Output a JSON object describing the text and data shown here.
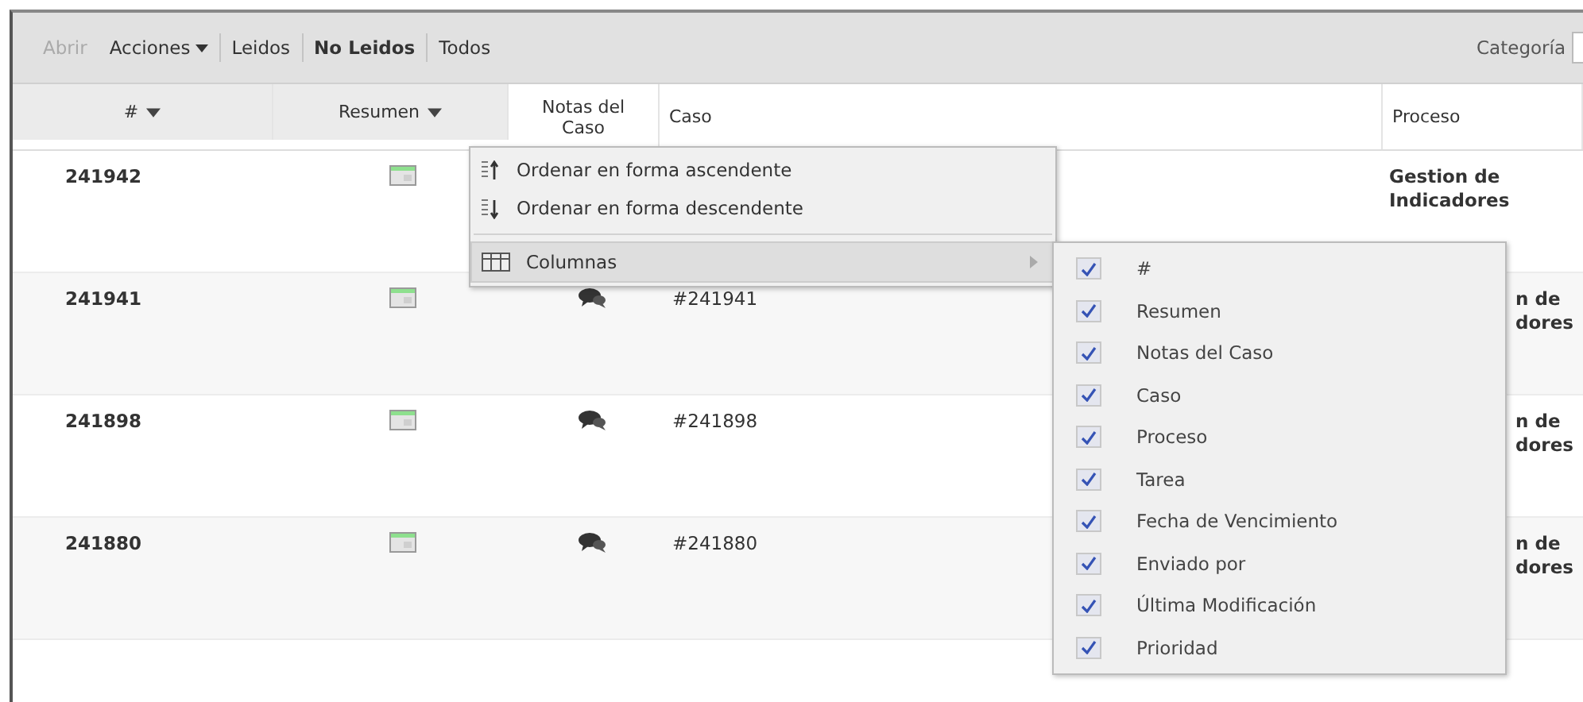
{
  "toolbar": {
    "items": [
      {
        "label": "Abrir",
        "kind": "action",
        "disabled": true,
        "selected": false
      },
      {
        "label": "Acciones",
        "kind": "dropdown",
        "disabled": false,
        "selected": false
      },
      {
        "label": "Leidos",
        "kind": "filter",
        "disabled": false,
        "selected": false
      },
      {
        "label": "No Leidos",
        "kind": "filter",
        "disabled": false,
        "selected": true
      },
      {
        "label": "Todos",
        "kind": "filter",
        "disabled": false,
        "selected": false
      }
    ],
    "category_label": "Categoría"
  },
  "table": {
    "columns": [
      {
        "label": "#",
        "sortable": true
      },
      {
        "label": "Resumen",
        "sortable": true
      },
      {
        "label": "Notas del Caso",
        "sortable": false
      },
      {
        "label": "Caso",
        "sortable": false
      },
      {
        "label": "Proceso",
        "sortable": false
      }
    ],
    "rows": [
      {
        "id": "241942",
        "proceso": [
          "Gestion de",
          "Indicadores"
        ],
        "proceso_cut": false
      },
      {
        "id": "241941",
        "notes": true,
        "caso": "#241941",
        "proceso": [
          "n de",
          "dores"
        ],
        "proceso_cut": true
      },
      {
        "id": "241898",
        "notes": true,
        "caso": "#241898",
        "proceso": [
          "n de",
          "dores"
        ],
        "proceso_cut": true
      },
      {
        "id": "241880",
        "notes": true,
        "caso": "#241880",
        "proceso": [
          "n de",
          "dores"
        ],
        "proceso_cut": true
      }
    ]
  },
  "column_menu": {
    "items": [
      {
        "label": "Ordenar en forma ascendente",
        "kind": "sort-asc",
        "expanded": false
      },
      {
        "label": "Ordenar en forma descendente",
        "kind": "sort-desc",
        "expanded": false
      },
      {
        "label": "Columnas",
        "kind": "submenu",
        "expanded": true
      }
    ]
  },
  "columns_submenu": {
    "items": [
      {
        "label": "#",
        "checked": true
      },
      {
        "label": "Resumen",
        "checked": true
      },
      {
        "label": "Notas del Caso",
        "checked": true
      },
      {
        "label": "Caso",
        "checked": true
      },
      {
        "label": "Proceso",
        "checked": true
      },
      {
        "label": "Tarea",
        "checked": true
      },
      {
        "label": "Fecha de Vencimiento",
        "checked": true
      },
      {
        "label": "Enviado por",
        "checked": true
      },
      {
        "label": "Última Modificación",
        "checked": true
      },
      {
        "label": "Prioridad",
        "checked": true
      }
    ]
  }
}
